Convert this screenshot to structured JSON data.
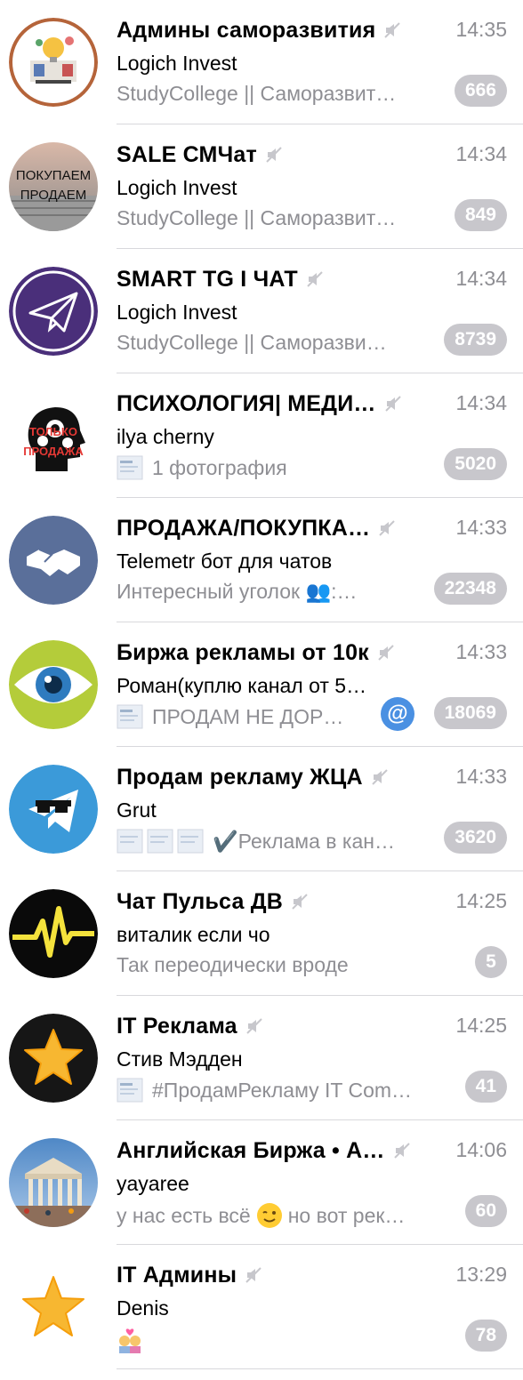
{
  "colors": {
    "badge_muted": "#c8c7cc",
    "mention": "#4a90e2",
    "time": "#8e8e93"
  },
  "chats": [
    {
      "title": "Админы саморазвития",
      "time": "14:35",
      "sender": "Logich Invest",
      "preview": "StudyCollege || Саморазвит…",
      "unread": "666",
      "avatar": "admins-selfdev-avatar"
    },
    {
      "title": "SALE СМЧат",
      "time": "14:34",
      "sender": "Logich Invest",
      "preview": "StudyCollege || Саморазвит…",
      "unread": "849",
      "avatar": "buy-sell-avatar",
      "avatar_text": [
        "ПОКУПАЕМ",
        "ПРОДАЕМ"
      ]
    },
    {
      "title": "SMART TG I ЧАТ",
      "time": "14:34",
      "sender": "Logich Invest",
      "preview": "StudyCollege || Саморазви…",
      "unread": "8739",
      "avatar": "paper-plane-avatar"
    },
    {
      "title": "ПСИХОЛОГИЯ| МЕДИ…",
      "time": "14:34",
      "sender": "ilya cherny",
      "preview": "1 фотография",
      "unread": "5020",
      "avatar": "head-gears-avatar",
      "avatar_text": [
        "ТОЛЬКО",
        "ПРОДАЖА"
      ]
    },
    {
      "title": "ПРОДАЖА/ПОКУПКА…",
      "time": "14:33",
      "sender": "Telemetr бот для чатов",
      "preview": "Интересный уголок  👥:…",
      "unread": "22348",
      "avatar": "handshake-avatar"
    },
    {
      "title": "Биржа рекламы от 10к",
      "time": "14:33",
      "sender": "Роман(куплю канал от 5…",
      "preview": "ПРОДАМ НЕ ДОР…",
      "unread": "18069",
      "mention": "@",
      "avatar": "eye-avatar"
    },
    {
      "title": "Продам рекламу ЖЦА",
      "time": "14:33",
      "sender": "Grut",
      "preview": "✔️Реклама в кан…",
      "unread": "3620",
      "avatar": "telegram-glasses-avatar"
    },
    {
      "title": "Чат Пульса ДВ",
      "time": "14:25",
      "sender": "виталик если чо",
      "preview": "Так переодически вроде",
      "unread": "5",
      "avatar": "pulse-avatar"
    },
    {
      "title": "IT Реклама",
      "time": "14:25",
      "sender": "Стив Мэдден",
      "preview": "#ПродамРекламу  IT Com…",
      "unread": "41",
      "avatar": "star-dark-avatar"
    },
    {
      "title": "Английская Биржа • А…",
      "time": "14:06",
      "sender": "yayaree",
      "preview_a": "у нас есть всё",
      "preview_b": "но вот рек…",
      "unread": "60",
      "avatar": "exchange-building-avatar"
    },
    {
      "title": "IT Админы",
      "time": "13:29",
      "sender": "Denis",
      "preview": "",
      "unread": "78",
      "avatar": "star-light-avatar"
    }
  ]
}
